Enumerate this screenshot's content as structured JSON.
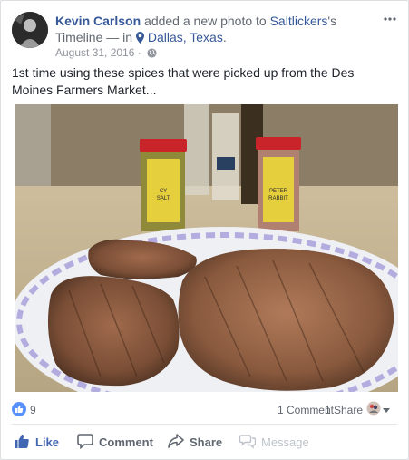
{
  "post": {
    "author": "Kevin Carlson",
    "action_text": " added a new photo to ",
    "target": "Saltlickers",
    "target_suffix": "'s Timeline — in ",
    "location": "Dallas, Texas",
    "location_suffix": ".",
    "date": "August 31, 2016 · ",
    "caption": "1st time using these spices that were picked up from the Des Moines Farmers Market...",
    "photo_labels": {
      "left_jar": "CY\nSALT",
      "right_jar": "PETER\nRABBIT"
    }
  },
  "stats": {
    "likes": "9",
    "comments": "1 Comment",
    "shares": "1 Share"
  },
  "actions": {
    "like": "Like",
    "comment": "Comment",
    "share": "Share",
    "message": "Message"
  },
  "colors": {
    "link": "#365899",
    "like_blue": "#4267b2",
    "badge_blue": "#5890ff"
  },
  "icons": [
    "more-options-icon",
    "location-pin-icon",
    "globe-icon",
    "like-reaction-icon",
    "viewer-icon",
    "dropdown-icon",
    "thumbs-up-icon",
    "comment-icon",
    "share-icon",
    "message-icon"
  ]
}
